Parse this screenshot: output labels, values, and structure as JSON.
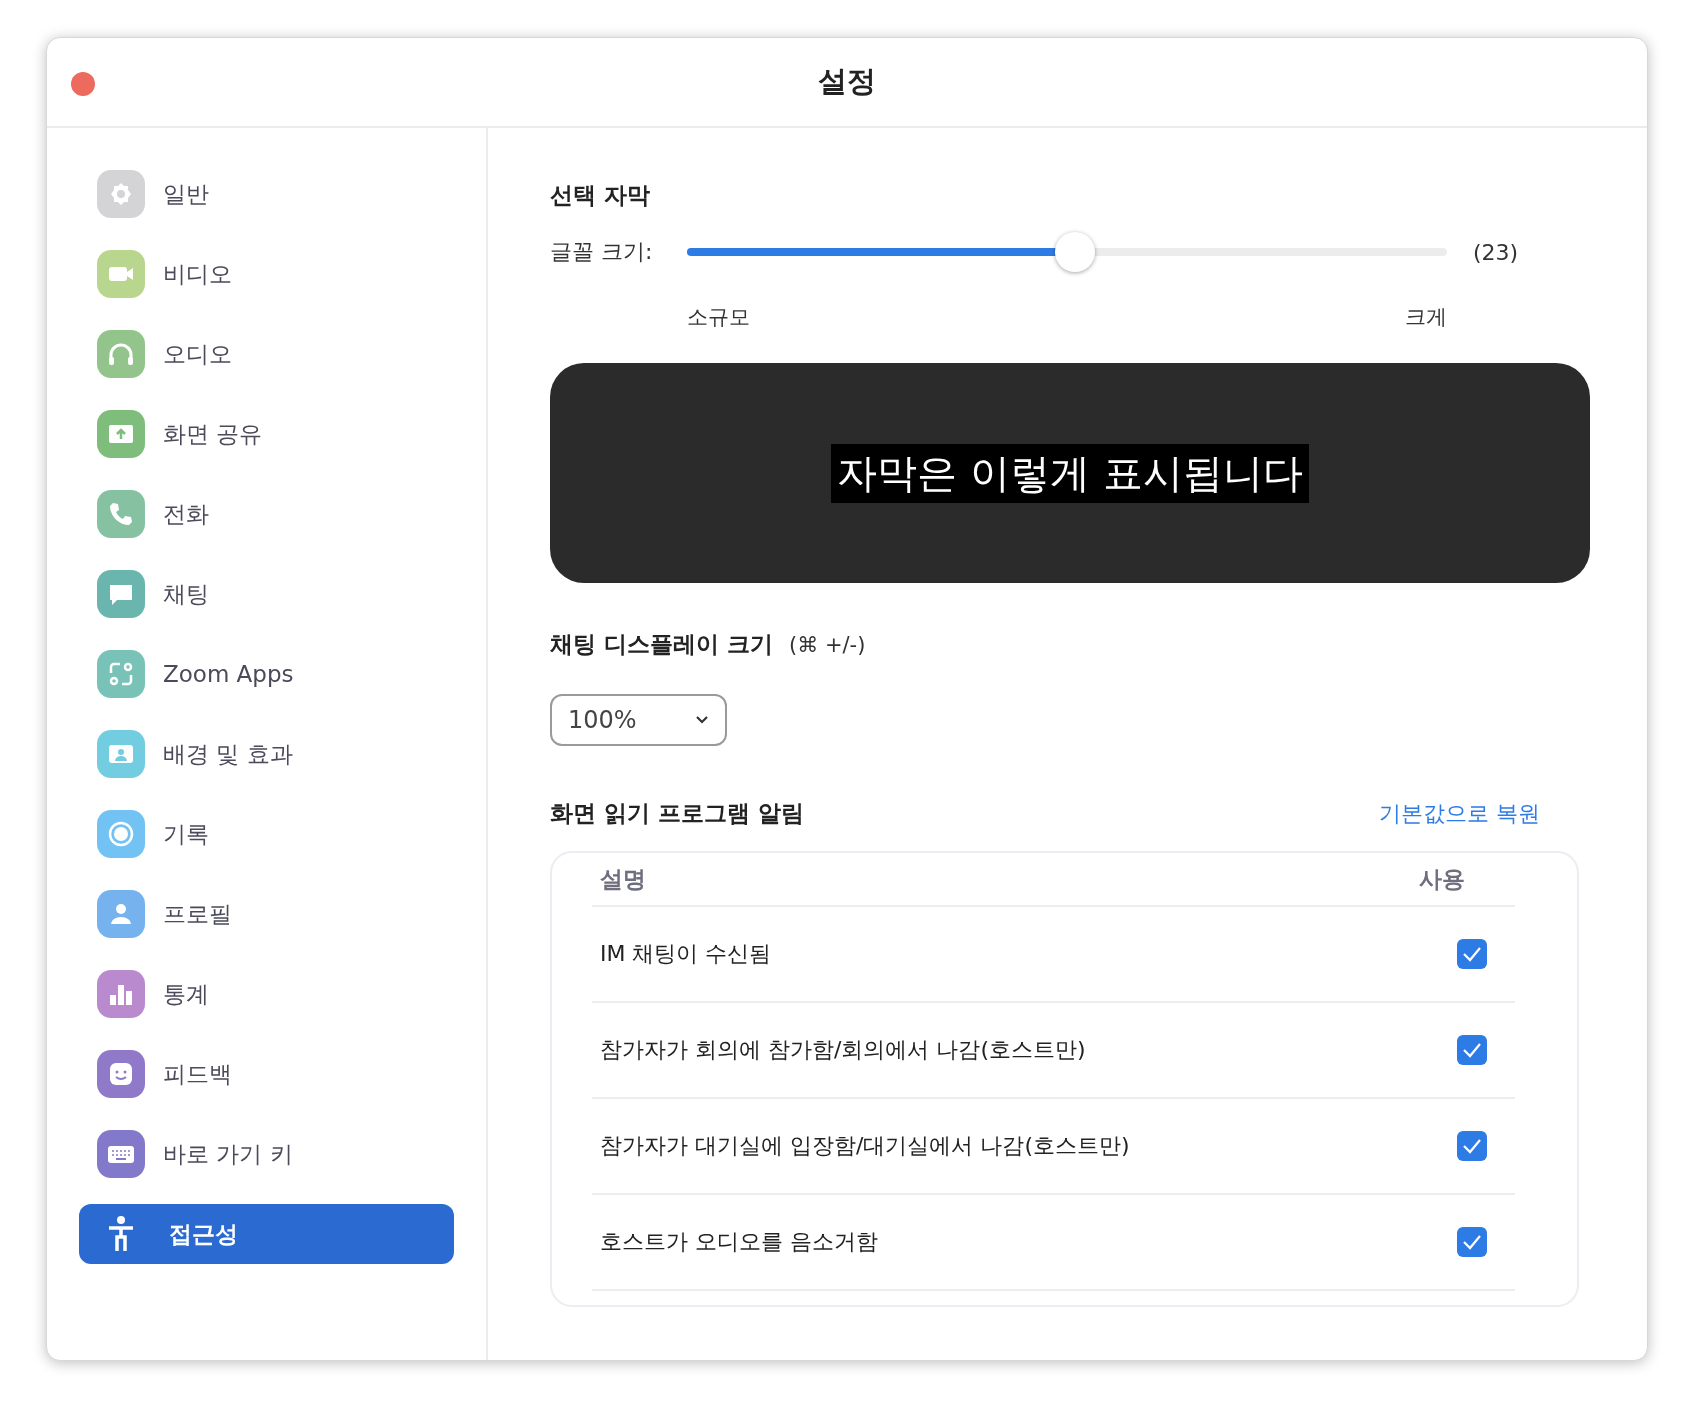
{
  "window": {
    "title": "설정"
  },
  "sidebar": {
    "items": [
      {
        "label": "일반",
        "color": "#d4d4d6",
        "selected": false
      },
      {
        "label": "비디오",
        "color": "#b8d68e",
        "selected": false
      },
      {
        "label": "오디오",
        "color": "#93c48c",
        "selected": false
      },
      {
        "label": "화면 공유",
        "color": "#7fbd7c",
        "selected": false
      },
      {
        "label": "전화",
        "color": "#86c2a2",
        "selected": false
      },
      {
        "label": "채팅",
        "color": "#6ab5ad",
        "selected": false
      },
      {
        "label": "Zoom Apps",
        "color": "#78c2b8",
        "selected": false
      },
      {
        "label": "배경 및 효과",
        "color": "#72cde0",
        "selected": false
      },
      {
        "label": "기록",
        "color": "#72c3f3",
        "selected": false
      },
      {
        "label": "프로필",
        "color": "#75b2ee",
        "selected": false
      },
      {
        "label": "통계",
        "color": "#b98bce",
        "selected": false
      },
      {
        "label": "피드백",
        "color": "#9079c8",
        "selected": false
      },
      {
        "label": "바로 가기 키",
        "color": "#8379cb",
        "selected": false
      },
      {
        "label": "접근성",
        "selected": true
      }
    ]
  },
  "captions": {
    "title": "선택 자막",
    "font_size_label": "글꼴 크기:",
    "level": 0.51,
    "reading": "(23)",
    "min_label": "소규모",
    "max_label": "크게",
    "preview": "자막은 이렇게 표시됩니다"
  },
  "chat_display": {
    "title": "채팅 디스플레이 크기",
    "shortcut": "(⌘ +/-)",
    "value": "100%"
  },
  "screen_reader": {
    "title": "화면 읽기 프로그램 알림",
    "reset_link": "기본값으로 복원",
    "columns": [
      "설명",
      "사용"
    ],
    "rows": [
      {
        "label": "IM 채팅이 수신됨",
        "checked": true
      },
      {
        "label": "참가자가 회의에 참가함/회의에서 나감(호스트만)",
        "checked": true
      },
      {
        "label": "참가자가 대기실에 입장함/대기실에서 나감(호스트만)",
        "checked": true
      },
      {
        "label": "호스트가 오디오를 음소거함",
        "checked": true
      }
    ]
  }
}
